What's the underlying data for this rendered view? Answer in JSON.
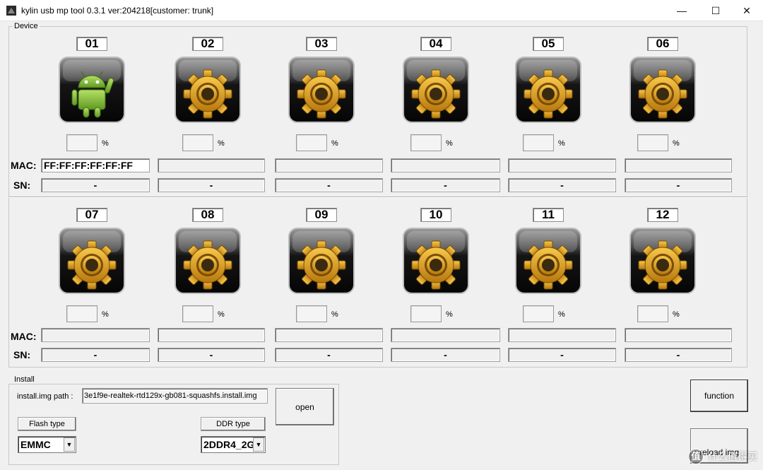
{
  "window": {
    "title": "kylin usb mp tool 0.3.1 ver:204218[customer: trunk]",
    "minimize_glyph": "—",
    "maximize_glyph": "☐",
    "close_glyph": "✕"
  },
  "device": {
    "label": "Device",
    "mac_label": "MAC:",
    "sn_label": "SN:",
    "pct_sign": "%",
    "slots": [
      {
        "num": "01",
        "icon": "android-icon",
        "mac": "FF:FF:FF:FF:FF:FF",
        "sn": "-"
      },
      {
        "num": "02",
        "icon": "gear-icon",
        "mac": "",
        "sn": "-"
      },
      {
        "num": "03",
        "icon": "gear-icon",
        "mac": "",
        "sn": "-"
      },
      {
        "num": "04",
        "icon": "gear-icon",
        "mac": "",
        "sn": "-"
      },
      {
        "num": "05",
        "icon": "gear-icon",
        "mac": "",
        "sn": "-"
      },
      {
        "num": "06",
        "icon": "gear-icon",
        "mac": "",
        "sn": "-"
      },
      {
        "num": "07",
        "icon": "gear-icon",
        "mac": "",
        "sn": "-"
      },
      {
        "num": "08",
        "icon": "gear-icon",
        "mac": "",
        "sn": "-"
      },
      {
        "num": "09",
        "icon": "gear-icon",
        "mac": "",
        "sn": "-"
      },
      {
        "num": "10",
        "icon": "gear-icon",
        "mac": "",
        "sn": "-"
      },
      {
        "num": "11",
        "icon": "gear-icon",
        "mac": "",
        "sn": "-"
      },
      {
        "num": "12",
        "icon": "gear-icon",
        "mac": "",
        "sn": "-"
      }
    ]
  },
  "install": {
    "label": "Install",
    "path_label": "install.img path :",
    "path_value": "3e1f9e-realtek-rtd129x-gb081-squashfs.install.img",
    "open_button": "open",
    "flash_type_label": "Flash type",
    "flash_type_value": "EMMC",
    "ddr_type_label": "DDR type",
    "ddr_type_value": "2DDR4_2G",
    "dropdown_glyph": "▼"
  },
  "buttons": {
    "function": "function",
    "reload_img": "reload img"
  },
  "watermark": {
    "badge": "值",
    "text": "什么值得买"
  },
  "colors": {
    "gear": "#e0a21e",
    "android": "#8cc63f",
    "tile": "#1c1c1c"
  }
}
